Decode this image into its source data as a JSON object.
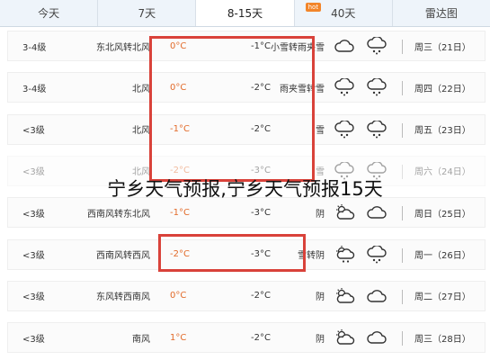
{
  "tabs": [
    {
      "label": "今天"
    },
    {
      "label": "7天"
    },
    {
      "label": "8-15天"
    },
    {
      "label": "40天",
      "badge": "hot"
    },
    {
      "label": "雷达图"
    }
  ],
  "active_tab_index": 2,
  "colors": {
    "highlight": "#d9423a",
    "high_temp": "#e26b2a",
    "tab_bar": "#eef4fa"
  },
  "rows": [
    {
      "day": "周三（21日）",
      "icons": [
        "cloud-outline-icon",
        "snow-cloud-icon"
      ],
      "condition": "小雪转雨夹雪",
      "temp_high": "0°C",
      "temp_low": "-1°C",
      "wind_dir": "东北风转北风",
      "wind_level": "3-4级"
    },
    {
      "day": "周四（22日）",
      "icons": [
        "snow-cloud-icon",
        "snow-cloud-icon"
      ],
      "condition": "雨夹雪转雪",
      "temp_high": "0°C",
      "temp_low": "-2°C",
      "wind_dir": "北风",
      "wind_level": "3-4级"
    },
    {
      "day": "周五（23日）",
      "icons": [
        "snow-cloud-icon",
        "snow-cloud-icon"
      ],
      "condition": "雪",
      "temp_high": "-1°C",
      "temp_low": "-2°C",
      "wind_dir": "北风",
      "wind_level": "<3级"
    },
    {
      "day": "周六（24日）",
      "icons": [
        "snow-cloud-icon",
        "snow-cloud-icon"
      ],
      "condition": "雪",
      "temp_high": "-2°C",
      "temp_low": "-3°C",
      "wind_dir": "北风",
      "wind_level": "<3级"
    },
    {
      "day": "周日（25日）",
      "icons": [
        "partly-cloudy-icon",
        "cloud-outline-icon"
      ],
      "condition": "阴",
      "temp_high": "-1°C",
      "temp_low": "-3°C",
      "wind_dir": "西南风转东北风",
      "wind_level": "<3级"
    },
    {
      "day": "周一（26日）",
      "icons": [
        "snow-sun-icon",
        "snow-cloud-icon"
      ],
      "condition": "雪转阴",
      "temp_high": "-2°C",
      "temp_low": "-3°C",
      "wind_dir": "西南风转西风",
      "wind_level": "<3级"
    },
    {
      "day": "周二（27日）",
      "icons": [
        "partly-cloudy-icon",
        "cloud-outline-icon"
      ],
      "condition": "阴",
      "temp_high": "0°C",
      "temp_low": "-2°C",
      "wind_dir": "东风转西南风",
      "wind_level": "<3级"
    },
    {
      "day": "周三（28日）",
      "icons": [
        "partly-cloudy-icon",
        "cloud-outline-icon"
      ],
      "condition": "阴",
      "temp_high": "1°C",
      "temp_low": "-2°C",
      "wind_dir": "南风",
      "wind_level": "<3级"
    }
  ],
  "watermark": "宁乡天气预报,宁乡天气预报15天"
}
